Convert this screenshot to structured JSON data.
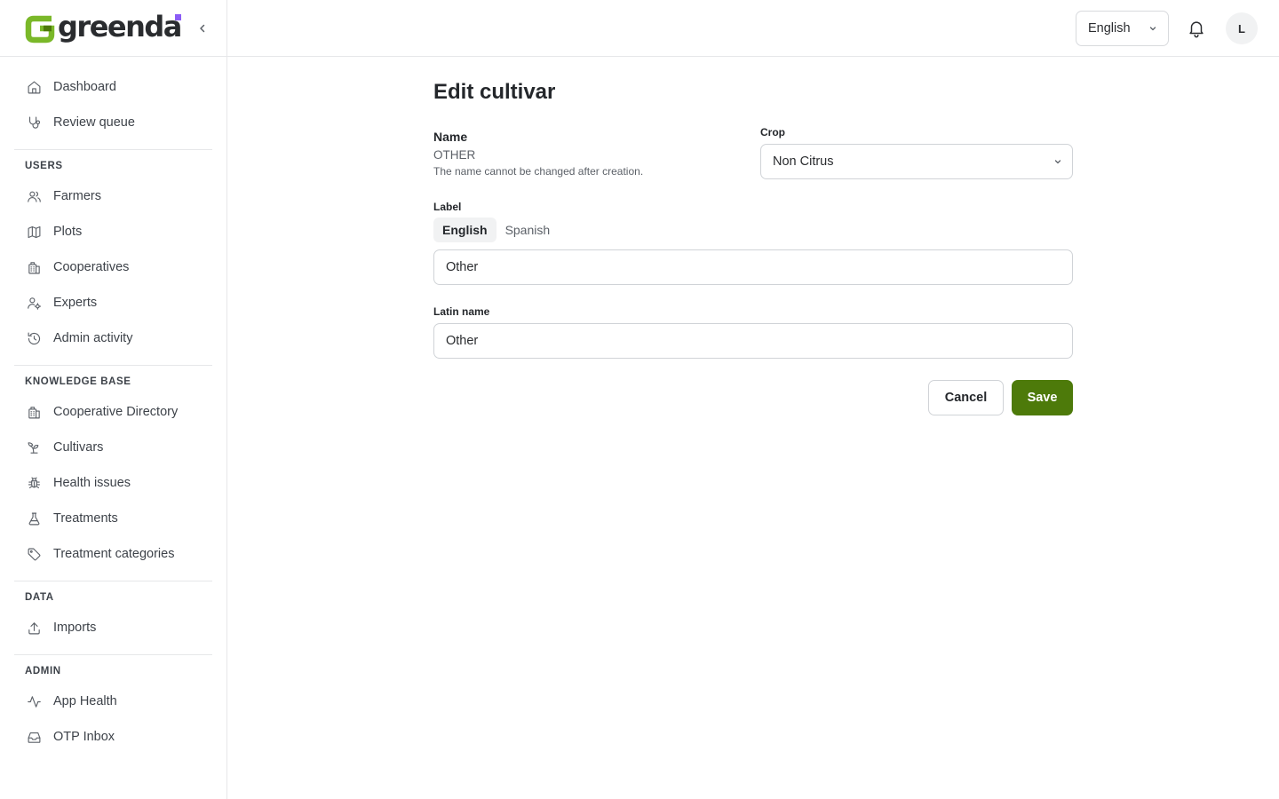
{
  "brand": {
    "name": "greenda",
    "logo_icon": "greenda-g-logo"
  },
  "colors": {
    "accent": "#4d7a0a",
    "logo_green": "#7ab829",
    "logo_dot": "#8b5cf6"
  },
  "sidebar": {
    "top_items": [
      {
        "label": "Dashboard",
        "icon": "home-icon"
      },
      {
        "label": "Review queue",
        "icon": "stethoscope-icon"
      }
    ],
    "sections": [
      {
        "title": "USERS",
        "items": [
          {
            "label": "Farmers",
            "icon": "users-icon"
          },
          {
            "label": "Plots",
            "icon": "map-icon"
          },
          {
            "label": "Cooperatives",
            "icon": "building-icon"
          },
          {
            "label": "Experts",
            "icon": "user-cog-icon"
          },
          {
            "label": "Admin activity",
            "icon": "history-icon"
          }
        ]
      },
      {
        "title": "KNOWLEDGE BASE",
        "items": [
          {
            "label": "Cooperative Directory",
            "icon": "building-icon"
          },
          {
            "label": "Cultivars",
            "icon": "sprout-icon"
          },
          {
            "label": "Health issues",
            "icon": "bug-icon"
          },
          {
            "label": "Treatments",
            "icon": "flask-icon"
          },
          {
            "label": "Treatment categories",
            "icon": "tag-icon"
          }
        ]
      },
      {
        "title": "DATA",
        "items": [
          {
            "label": "Imports",
            "icon": "upload-icon"
          }
        ]
      },
      {
        "title": "ADMIN",
        "items": [
          {
            "label": "App Health",
            "icon": "activity-icon"
          },
          {
            "label": "OTP Inbox",
            "icon": "inbox-icon"
          }
        ]
      }
    ]
  },
  "topbar": {
    "language": "English",
    "avatar_initial": "L"
  },
  "form": {
    "title": "Edit cultivar",
    "name_label": "Name",
    "name_value": "OTHER",
    "name_help": "The name cannot be changed after creation.",
    "crop_label": "Crop",
    "crop_value": "Non Citrus",
    "label_label": "Label",
    "label_tabs": [
      "English",
      "Spanish"
    ],
    "label_active_tab": "English",
    "label_value": "Other",
    "latin_label": "Latin name",
    "latin_value": "Other",
    "cancel_label": "Cancel",
    "save_label": "Save"
  }
}
